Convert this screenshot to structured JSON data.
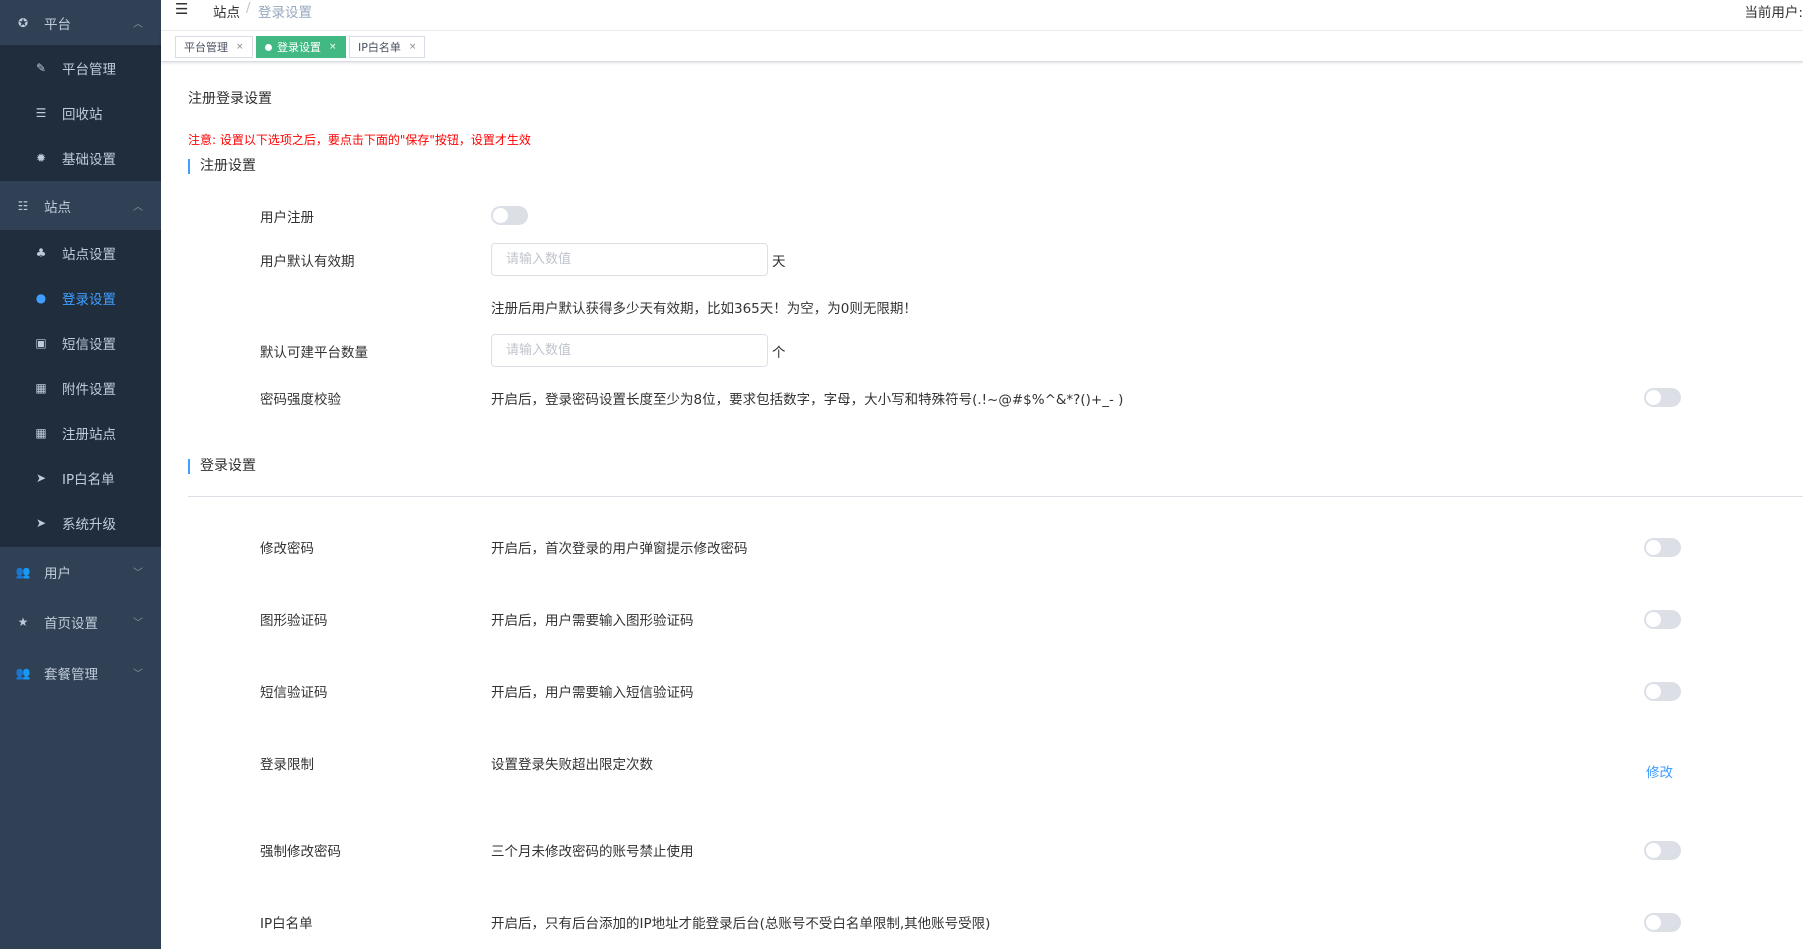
{
  "sidebar": {
    "groups": [
      {
        "label": "平台",
        "items": [
          "平台管理",
          "回收站",
          "基础设置"
        ]
      },
      {
        "label": "站点",
        "items": [
          "站点设置",
          "登录设置",
          "短信设置",
          "附件设置",
          "注册站点",
          "IP白名单",
          "系统升级"
        ]
      },
      {
        "label": "用户"
      },
      {
        "label": "首页设置"
      },
      {
        "label": "套餐管理"
      }
    ],
    "active_item": "登录设置",
    "accent": "#409eff"
  },
  "header": {
    "breadcrumb": [
      "站点",
      "登录设置"
    ],
    "separator": "/",
    "current_user_label": "当前用户:"
  },
  "tabs": [
    {
      "label": "平台管理"
    },
    {
      "label": "登录设置",
      "active": true
    },
    {
      "label": "IP白名单"
    }
  ],
  "tab_close": "×",
  "main": {
    "title": "注册登录设置",
    "notice": "注意: 设置以下选项之后，要点击下面的\"保存\"按钮，设置才生效",
    "register_section": "注册设置",
    "user_register": "用户注册",
    "default_validity": {
      "label": "用户默认有效期",
      "placeholder": "请输入数值",
      "unit": "天",
      "hint": "注册后用户默认获得多少天有效期，比如365天！为空，为0则无限期！"
    },
    "platform_count": {
      "label": "默认可建平台数量",
      "placeholder": "请输入数值",
      "unit": "个"
    },
    "password_strength": {
      "label": "密码强度校验",
      "desc": "开启后，登录密码设置长度至少为8位，要求包括数字，字母，大小写和特殊符号(.!~@#$%^&*?()+_- )"
    },
    "login_section": "登录设置",
    "login_rows": [
      {
        "label": "修改密码",
        "desc": "开启后，首次登录的用户弹窗提示修改密码"
      },
      {
        "label": "图形验证码",
        "desc": "开启后，用户需要输入图形验证码"
      },
      {
        "label": "短信验证码",
        "desc": "开启后，用户需要输入短信验证码"
      },
      {
        "label": "登录限制",
        "desc": "设置登录失败超出限定次数",
        "action": "修改"
      },
      {
        "label": "强制修改密码",
        "desc": "三个月未修改密码的账号禁止使用"
      },
      {
        "label": "IP白名单",
        "desc": "开启后，只有后台添加的IP地址才能登录后台(总账号不受白名单限制,其他账号受限)"
      }
    ]
  }
}
